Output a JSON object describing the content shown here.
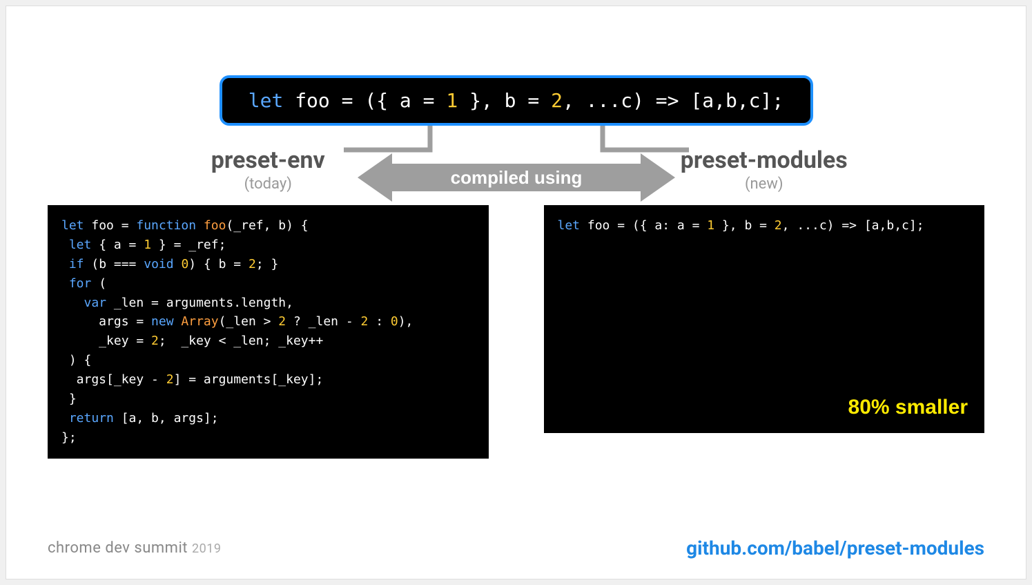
{
  "source_code": {
    "raw": "let foo = ({ a = 1 }, b = 2, ...c) => [a,b,c];"
  },
  "arrow_label": "compiled using",
  "left": {
    "title": "preset-env",
    "subtitle": "(today)",
    "code_lines": [
      "let foo = function foo(_ref, b) {",
      " let { a = 1 } = _ref;",
      " if (b === void 0) { b = 2; }",
      " for (",
      "   var _len = arguments.length,",
      "     args = new Array(_len > 2 ? _len - 2 : 0),",
      "     _key = 2;  _key < _len; _key++",
      " ) {",
      "  args[_key - 2] = arguments[_key];",
      " }",
      " return [a, b, args];",
      "};"
    ]
  },
  "right": {
    "title": "preset-modules",
    "subtitle": "(new)",
    "code_lines": [
      "let foo = ({ a: a = 1 }, b = 2, ...c) => [a,b,c];"
    ],
    "callout": "80% smaller"
  },
  "footer": {
    "event": "chrome dev summit",
    "year": "2019",
    "link": "github.com/babel/preset-modules"
  }
}
